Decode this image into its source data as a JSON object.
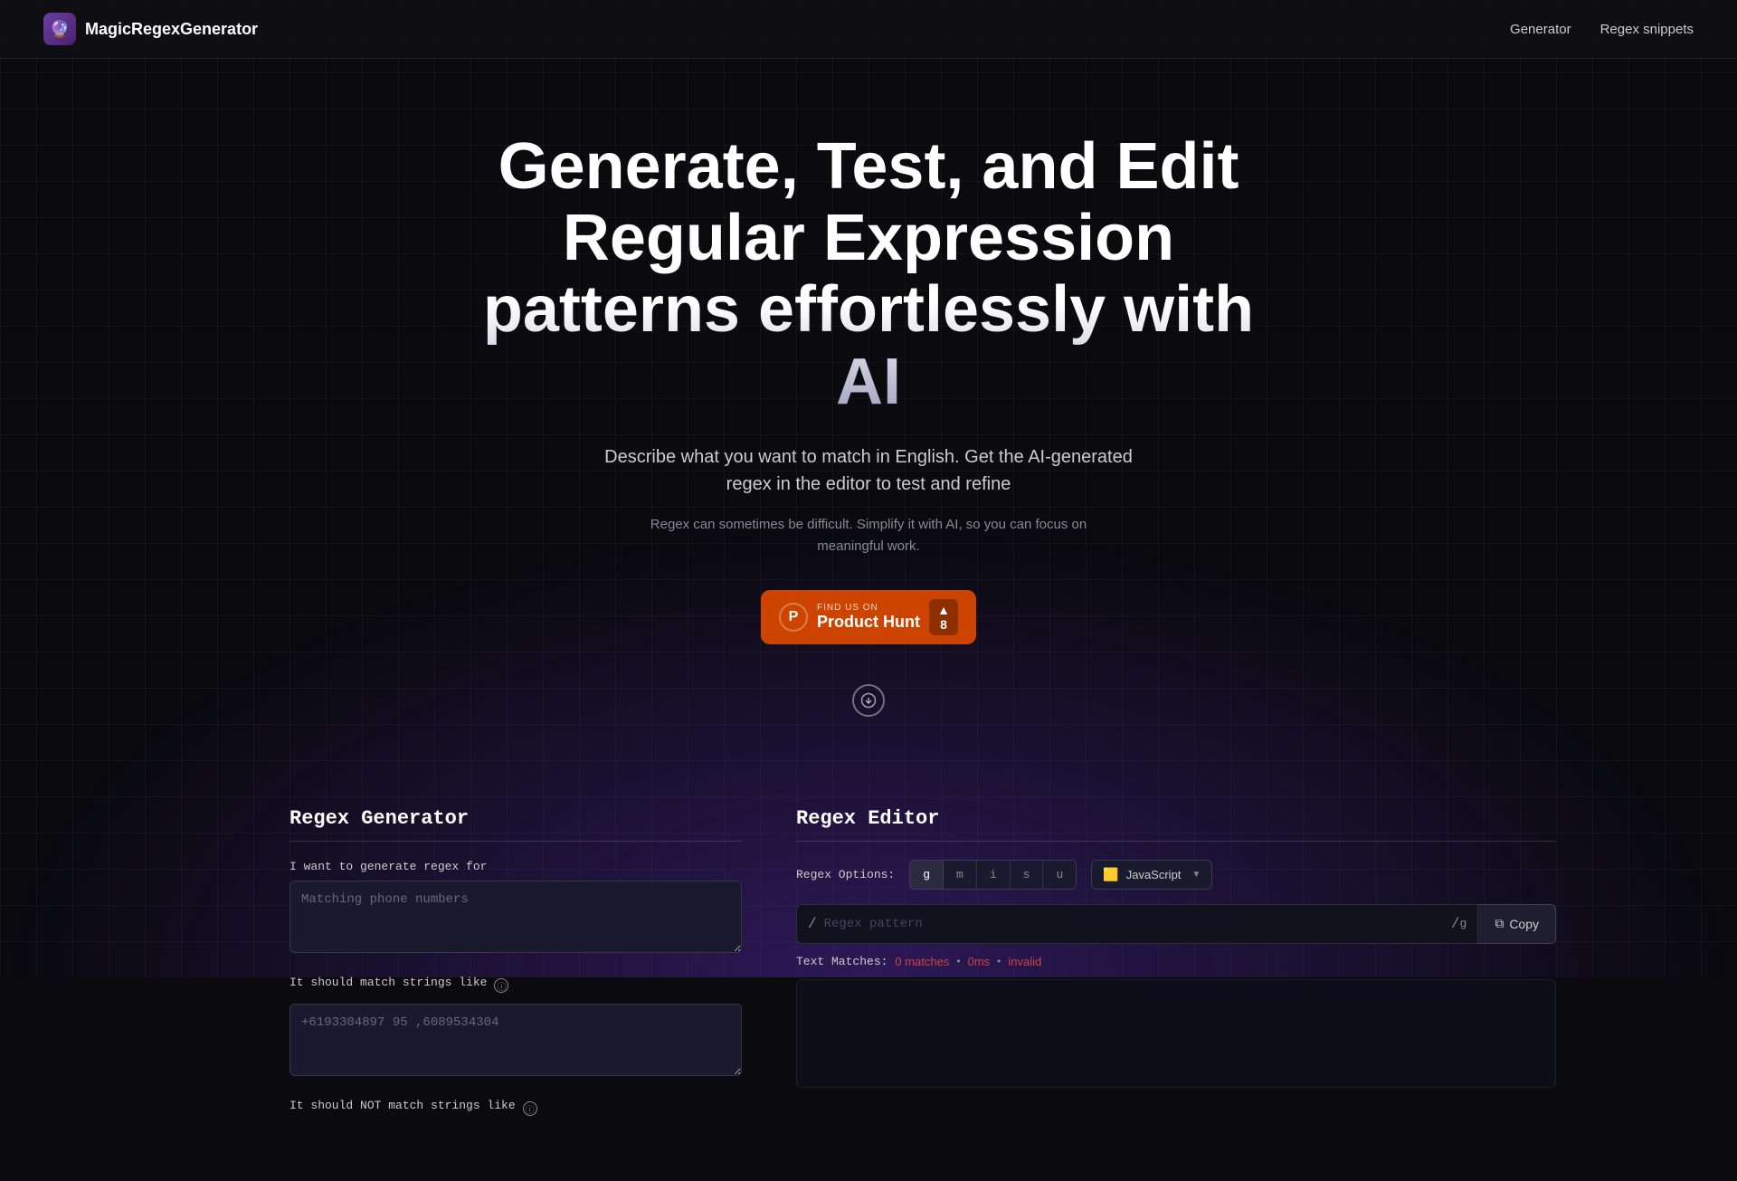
{
  "app": {
    "logo_emoji": "🔮",
    "logo_text": "MagicRegexGenerator"
  },
  "nav": {
    "links": [
      {
        "id": "generator",
        "label": "Generator"
      },
      {
        "id": "snippets",
        "label": "Regex snippets"
      }
    ]
  },
  "hero": {
    "title": "Generate, Test, and Edit Regular Expression patterns effortlessly with AI",
    "subtitle": "Describe what you want to match in English. Get the AI-generated regex in the editor to test and refine",
    "sub2": "Regex can sometimes be difficult. Simplify it with AI, so you can focus on meaningful work.",
    "product_hunt_find": "FIND US ON",
    "product_hunt_name": "Product Hunt",
    "product_hunt_count": "8",
    "scroll_icon": "⬇"
  },
  "regex_generator": {
    "title": "Regex Generator",
    "label_want": "I want to generate regex for",
    "placeholder_want": "Matching phone numbers",
    "label_should_match": "It should match strings like",
    "placeholder_match": "+6193304897 95 ,6089534304",
    "label_should_not_match": "It should NOT match strings like"
  },
  "regex_editor": {
    "title": "Regex Editor",
    "options_label": "Regex Options:",
    "flags": [
      {
        "id": "g",
        "label": "g",
        "active": true
      },
      {
        "id": "m",
        "label": "m",
        "active": false
      },
      {
        "id": "i",
        "label": "i",
        "active": false
      },
      {
        "id": "s",
        "label": "s",
        "active": false
      },
      {
        "id": "u",
        "label": "u",
        "active": false
      }
    ],
    "language": "JavaScript",
    "language_emoji": "🟨",
    "regex_prefix": "/",
    "regex_suffix": "/g",
    "regex_placeholder": "Regex pattern",
    "copy_label": "Copy",
    "text_matches_label": "Text Matches:",
    "matches_count": "0 matches",
    "matches_ms": "0ms",
    "matches_invalid": "invalid"
  },
  "colors": {
    "accent_red": "#cc4444",
    "bg_dark": "#0a0a0f",
    "bg_panel": "#1a1a2e",
    "product_hunt_orange": "#cc4400"
  }
}
